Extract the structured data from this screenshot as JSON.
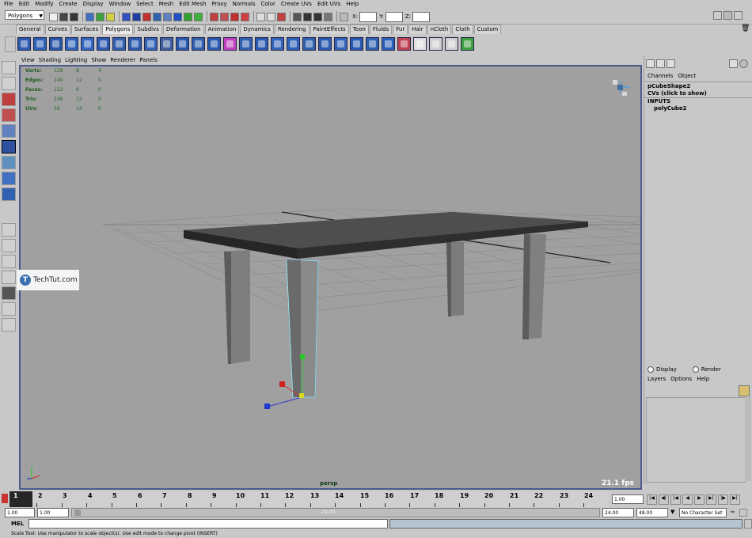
{
  "menubar": [
    "File",
    "Edit",
    "Modify",
    "Create",
    "Display",
    "Window",
    "Select",
    "Mesh",
    "Edit Mesh",
    "Proxy",
    "Normals",
    "Color",
    "Create UVs",
    "Edit UVs",
    "Help"
  ],
  "status": {
    "mode": "Polygons",
    "x_label": "X:",
    "y_label": "Y:",
    "z_label": "Z:"
  },
  "shelf_tabs": [
    "General",
    "Curves",
    "Surfaces",
    "Polygons",
    "Subdivs",
    "Deformation",
    "Animation",
    "Dynamics",
    "Rendering",
    "PaintEffects",
    "Toon",
    "Fluids",
    "Fur",
    "Hair",
    "nCloth",
    "Cloth",
    "Custom"
  ],
  "active_shelf_tab": "Polygons",
  "panel_menu": [
    "View",
    "Shading",
    "Lighting",
    "Show",
    "Renderer",
    "Panels"
  ],
  "hud": [
    {
      "label": "Verts:",
      "a": "128",
      "b": "8",
      "c": "4"
    },
    {
      "label": "Edges:",
      "a": "240",
      "b": "12",
      "c": "0"
    },
    {
      "label": "Faces:",
      "a": "122",
      "b": "6",
      "c": "0"
    },
    {
      "label": "Tris:",
      "a": "236",
      "b": "12",
      "c": "0"
    },
    {
      "label": "UVs:",
      "a": "56",
      "b": "14",
      "c": "0"
    }
  ],
  "camera_label": "persp",
  "fps": "21.1 fps",
  "watermark": {
    "letter": "T",
    "text": "TechTut.com"
  },
  "channel_box": {
    "menus": [
      "Channels",
      "Object"
    ],
    "object": "pCubeShape2",
    "cvs": "CVs (click to show)",
    "inputs": "INPUTS",
    "input_node": "polyCube2"
  },
  "layer_editor": {
    "display": "Display",
    "render": "Render",
    "menus": [
      "Layers",
      "Options",
      "Help"
    ]
  },
  "timeline": {
    "ticks": [
      "1",
      "2",
      "3",
      "4",
      "5",
      "6",
      "7",
      "8",
      "9",
      "10",
      "11",
      "12",
      "13",
      "14",
      "15",
      "16",
      "17",
      "18",
      "19",
      "20",
      "21",
      "22",
      "23",
      "24"
    ],
    "current": "1.00"
  },
  "range": {
    "start": "1.00",
    "inner_start": "1.00",
    "slider_label": "24.00",
    "end": "24.00",
    "max": "48.00",
    "charset": "No Character Set"
  },
  "command": {
    "label": "MEL"
  },
  "help_text": "Scale Tool: Use manipulator to scale object(s). Use edit mode to change pivot (INSERT)"
}
